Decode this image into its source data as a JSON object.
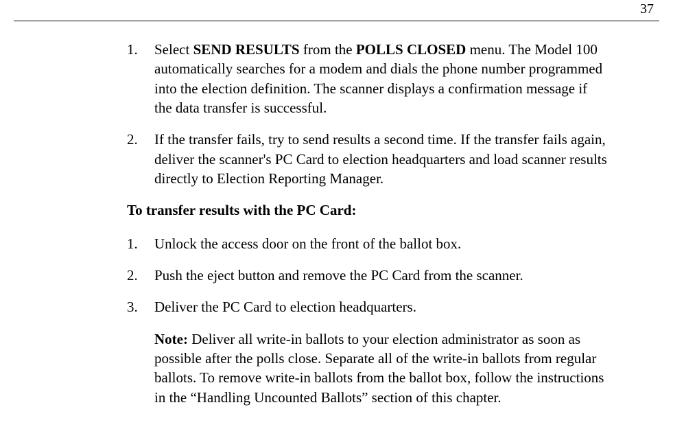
{
  "page_number": "37",
  "listA": {
    "num1": "1.",
    "item1": {
      "pre": "Select ",
      "b1": "SEND RESULTS",
      "mid": " from the ",
      "b2": "POLLS CLOSED",
      "post": " menu. The Model 100 automatically searches for a modem and dials the phone number programmed into the election definition. The scanner displays a confirmation message if the data transfer is successful."
    },
    "num2": "2.",
    "item2": "If the transfer fails, try to send results a second time. If the transfer fails again, deliver the scanner's PC Card to election headquarters and load scanner results directly to Election Reporting Manager."
  },
  "heading": "To transfer results with the PC Card:",
  "listB": {
    "num1": "1.",
    "item1": "Unlock the access door on the front of the ballot box.",
    "num2": "2.",
    "item2": "Push the eject button and remove the PC Card from the scanner.",
    "num3": "3.",
    "item3": "Deliver the PC Card to election headquarters."
  },
  "note": {
    "label": "Note:",
    "body": " Deliver all write-in ballots to your election administrator as soon as possible after the polls close. Separate all of the write-in ballots from regular ballots. To remove write-in ballots from the ballot box, follow the instructions in the “Handling Uncounted Ballots” section of this chapter."
  }
}
